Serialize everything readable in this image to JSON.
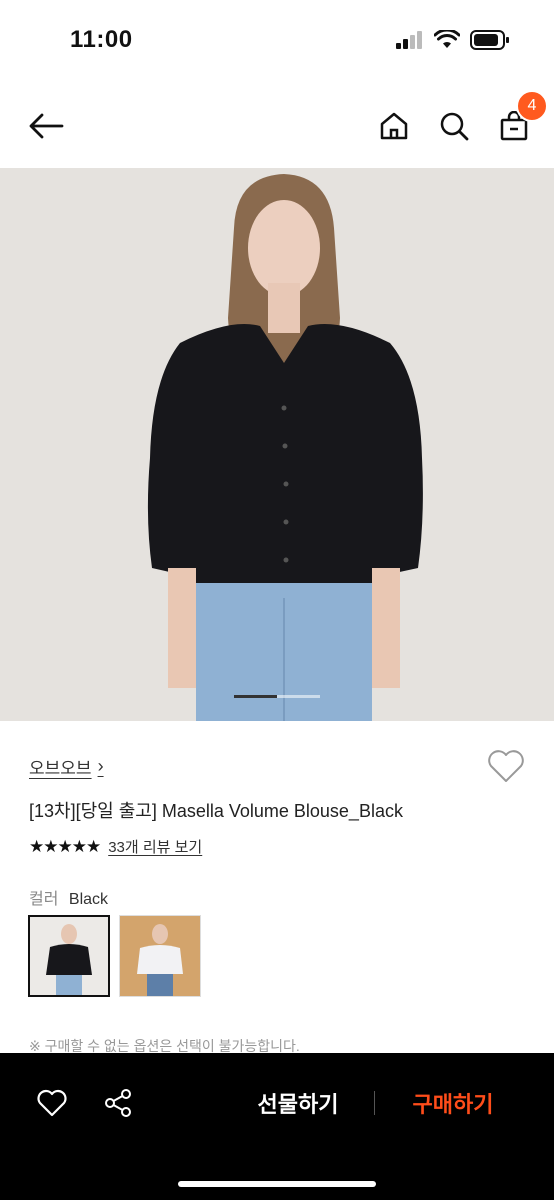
{
  "status_bar": {
    "time": "11:00",
    "icons": [
      "cellular-signal-icon",
      "wifi-icon",
      "battery-icon"
    ]
  },
  "nav": {
    "icons": [
      "back-arrow-icon",
      "home-icon",
      "search-icon",
      "shopping-bag-icon"
    ],
    "cart_count": "4",
    "badge_color": "#ff5a1f"
  },
  "image_carousel": {
    "active_index": 0,
    "total": 2
  },
  "product": {
    "brand": "오브오브",
    "brand_chevron": "›",
    "title": "[13차][당일 출고] Masella Volume Blouse_Black",
    "rating_stars": 4.5,
    "stars_text": "★★★★★",
    "review_link": "33개 리뷰 보기",
    "color_label": "컬러",
    "color_value": "Black",
    "notice": "※ 구매할 수 없는 옵션은 선택이 불가능합니다."
  },
  "bottom_bar": {
    "gift_label": "선물하기",
    "buy_label": "구매하기",
    "buy_color": "#ff4d1a",
    "icons": [
      "heart-outline-icon",
      "share-icon"
    ]
  }
}
